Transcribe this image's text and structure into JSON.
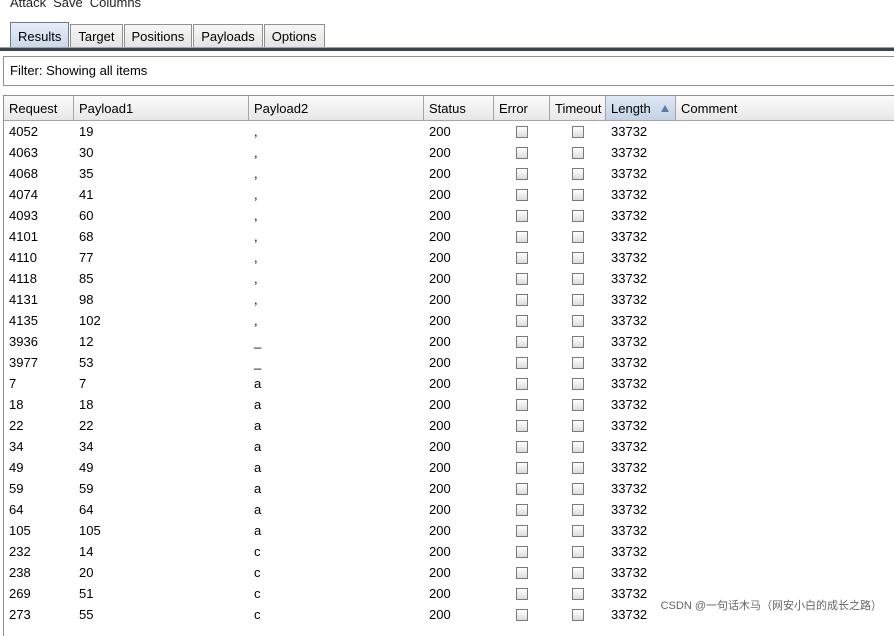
{
  "menu": [
    "Attack",
    "Save",
    "Columns"
  ],
  "tabs": [
    {
      "label": "Results",
      "active": true
    },
    {
      "label": "Target",
      "active": false
    },
    {
      "label": "Positions",
      "active": false
    },
    {
      "label": "Payloads",
      "active": false
    },
    {
      "label": "Options",
      "active": false
    }
  ],
  "filter": {
    "text": "Filter: Showing all items"
  },
  "columns": [
    "Request",
    "Payload1",
    "Payload2",
    "Status",
    "Error",
    "Timeout",
    "Length",
    "Comment"
  ],
  "sort_column": "Length",
  "rows": [
    {
      "request": "4052",
      "payload1": "19",
      "payload2": ",",
      "status": "200",
      "length": "33732"
    },
    {
      "request": "4063",
      "payload1": "30",
      "payload2": ",",
      "status": "200",
      "length": "33732"
    },
    {
      "request": "4068",
      "payload1": "35",
      "payload2": ",",
      "status": "200",
      "length": "33732"
    },
    {
      "request": "4074",
      "payload1": "41",
      "payload2": ",",
      "status": "200",
      "length": "33732"
    },
    {
      "request": "4093",
      "payload1": "60",
      "payload2": ",",
      "status": "200",
      "length": "33732"
    },
    {
      "request": "4101",
      "payload1": "68",
      "payload2": ",",
      "status": "200",
      "length": "33732"
    },
    {
      "request": "4110",
      "payload1": "77",
      "payload2": ",",
      "status": "200",
      "length": "33732"
    },
    {
      "request": "4118",
      "payload1": "85",
      "payload2": ",",
      "status": "200",
      "length": "33732"
    },
    {
      "request": "4131",
      "payload1": "98",
      "payload2": ",",
      "status": "200",
      "length": "33732"
    },
    {
      "request": "4135",
      "payload1": "102",
      "payload2": ",",
      "status": "200",
      "length": "33732"
    },
    {
      "request": "3936",
      "payload1": "12",
      "payload2": "_",
      "status": "200",
      "length": "33732"
    },
    {
      "request": "3977",
      "payload1": "53",
      "payload2": "_",
      "status": "200",
      "length": "33732"
    },
    {
      "request": "7",
      "payload1": "7",
      "payload2": "a",
      "status": "200",
      "length": "33732"
    },
    {
      "request": "18",
      "payload1": "18",
      "payload2": "a",
      "status": "200",
      "length": "33732"
    },
    {
      "request": "22",
      "payload1": "22",
      "payload2": "a",
      "status": "200",
      "length": "33732"
    },
    {
      "request": "34",
      "payload1": "34",
      "payload2": "a",
      "status": "200",
      "length": "33732"
    },
    {
      "request": "49",
      "payload1": "49",
      "payload2": "a",
      "status": "200",
      "length": "33732"
    },
    {
      "request": "59",
      "payload1": "59",
      "payload2": "a",
      "status": "200",
      "length": "33732"
    },
    {
      "request": "64",
      "payload1": "64",
      "payload2": "a",
      "status": "200",
      "length": "33732"
    },
    {
      "request": "105",
      "payload1": "105",
      "payload2": "a",
      "status": "200",
      "length": "33732"
    },
    {
      "request": "232",
      "payload1": "14",
      "payload2": "c",
      "status": "200",
      "length": "33732"
    },
    {
      "request": "238",
      "payload1": "20",
      "payload2": "c",
      "status": "200",
      "length": "33732"
    },
    {
      "request": "269",
      "payload1": "51",
      "payload2": "c",
      "status": "200",
      "length": "33732"
    },
    {
      "request": "273",
      "payload1": "55",
      "payload2": "c",
      "status": "200",
      "length": "33732"
    }
  ],
  "watermark": "CSDN @一句话木马（网安小白的成长之路）"
}
